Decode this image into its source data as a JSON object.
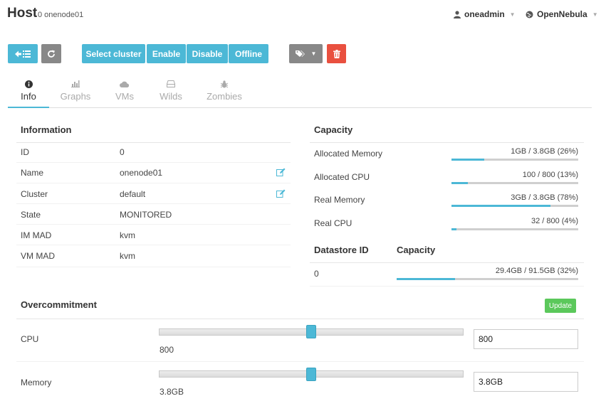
{
  "header": {
    "title": "Host",
    "subtitle": "0 onenode01",
    "user": "oneadmin",
    "zone": "OpenNebula"
  },
  "toolbar": {
    "back_icon": "arrow-left-list-icon",
    "refresh_icon": "refresh-icon",
    "select_cluster": "Select cluster",
    "enable": "Enable",
    "disable": "Disable",
    "offline": "Offline",
    "tags_icon": "tags-icon",
    "delete_icon": "trash-icon"
  },
  "tabs": [
    {
      "label": "Info",
      "icon": "info-icon",
      "active": true
    },
    {
      "label": "Graphs",
      "icon": "bar-chart-icon"
    },
    {
      "label": "VMs",
      "icon": "cloud-icon"
    },
    {
      "label": "Wilds",
      "icon": "hdd-icon"
    },
    {
      "label": "Zombies",
      "icon": "bug-icon"
    }
  ],
  "information": {
    "title": "Information",
    "rows": [
      {
        "label": "ID",
        "value": "0"
      },
      {
        "label": "Name",
        "value": "onenode01"
      },
      {
        "label": "Cluster",
        "value": "default"
      },
      {
        "label": "State",
        "value": "MONITORED"
      },
      {
        "label": "IM MAD",
        "value": "kvm"
      },
      {
        "label": "VM MAD",
        "value": "kvm"
      }
    ]
  },
  "capacity": {
    "title": "Capacity",
    "rows": [
      {
        "label": "Allocated Memory",
        "text": "1GB / 3.8GB (26%)",
        "fraction": 0.26
      },
      {
        "label": "Allocated CPU",
        "text": "100 / 800 (13%)",
        "fraction": 0.13
      },
      {
        "label": "Real Memory",
        "text": "3GB / 3.8GB (78%)",
        "fraction": 0.78
      },
      {
        "label": "Real CPU",
        "text": "32 / 800 (4%)",
        "fraction": 0.04
      }
    ]
  },
  "datastores": {
    "col_id": "Datastore ID",
    "col_capacity": "Capacity",
    "rows": [
      {
        "id": "0",
        "text": "29.4GB / 91.5GB (32%)",
        "fraction": 0.32
      }
    ]
  },
  "overcommitment": {
    "title": "Overcommitment",
    "update": "Update",
    "cpu": {
      "label": "CPU",
      "value": "800",
      "input": "800",
      "fraction": 0.5
    },
    "memory": {
      "label": "Memory",
      "value": "3.8GB",
      "input": "3.8GB",
      "fraction": 0.5
    }
  },
  "colors": {
    "accent": "#4cb8d6",
    "danger": "#e9503f",
    "success": "#5bc85b"
  }
}
